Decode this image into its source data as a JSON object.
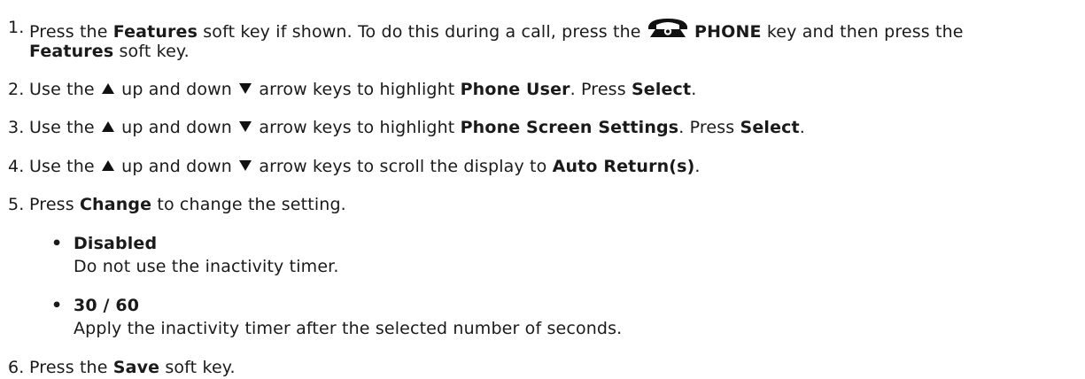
{
  "steps": [
    {
      "number": "1.",
      "part1": "Press the ",
      "features_label": "Features",
      "part2": " soft key if shown. To do this during a call, press the ",
      "icon": "phone-icon",
      "phone_label": "PHONE",
      "part3": " key and then press the",
      "features_label_2": "Features",
      "part4": " soft key."
    },
    {
      "number": "2.",
      "part1": "Use the ",
      "up_icon": "up-arrow-icon",
      "part2": " up and down ",
      "down_icon": "down-arrow-icon",
      "part3": " arrow keys to highlight ",
      "target": "Phone User",
      "part4": ". Press ",
      "action": "Select",
      "part5": "."
    },
    {
      "number": "3.",
      "part1": "Use the ",
      "up_icon": "up-arrow-icon",
      "part2": " up and down ",
      "down_icon": "down-arrow-icon",
      "part3": " arrow keys to highlight ",
      "target": "Phone Screen Settings",
      "part4": ". Press ",
      "action": "Select",
      "part5": "."
    },
    {
      "number": "4.",
      "part1": "Use the ",
      "up_icon": "up-arrow-icon",
      "part2": " up and down ",
      "down_icon": "down-arrow-icon",
      "part3": " arrow keys to scroll the display to ",
      "target": "Auto Return(s)",
      "part4": "."
    },
    {
      "number": "5.",
      "part1": "Press ",
      "action": "Change",
      "part2": " to change the setting.",
      "options": [
        {
          "bullet": "•",
          "title": "Disabled",
          "description": "Do not use the inactivity timer."
        },
        {
          "bullet": "•",
          "title": "30 / 60",
          "description": "Apply the inactivity timer after the selected number of seconds."
        }
      ]
    },
    {
      "number": "6.",
      "part1": "Press the ",
      "action": "Save",
      "part2": " soft key."
    }
  ]
}
